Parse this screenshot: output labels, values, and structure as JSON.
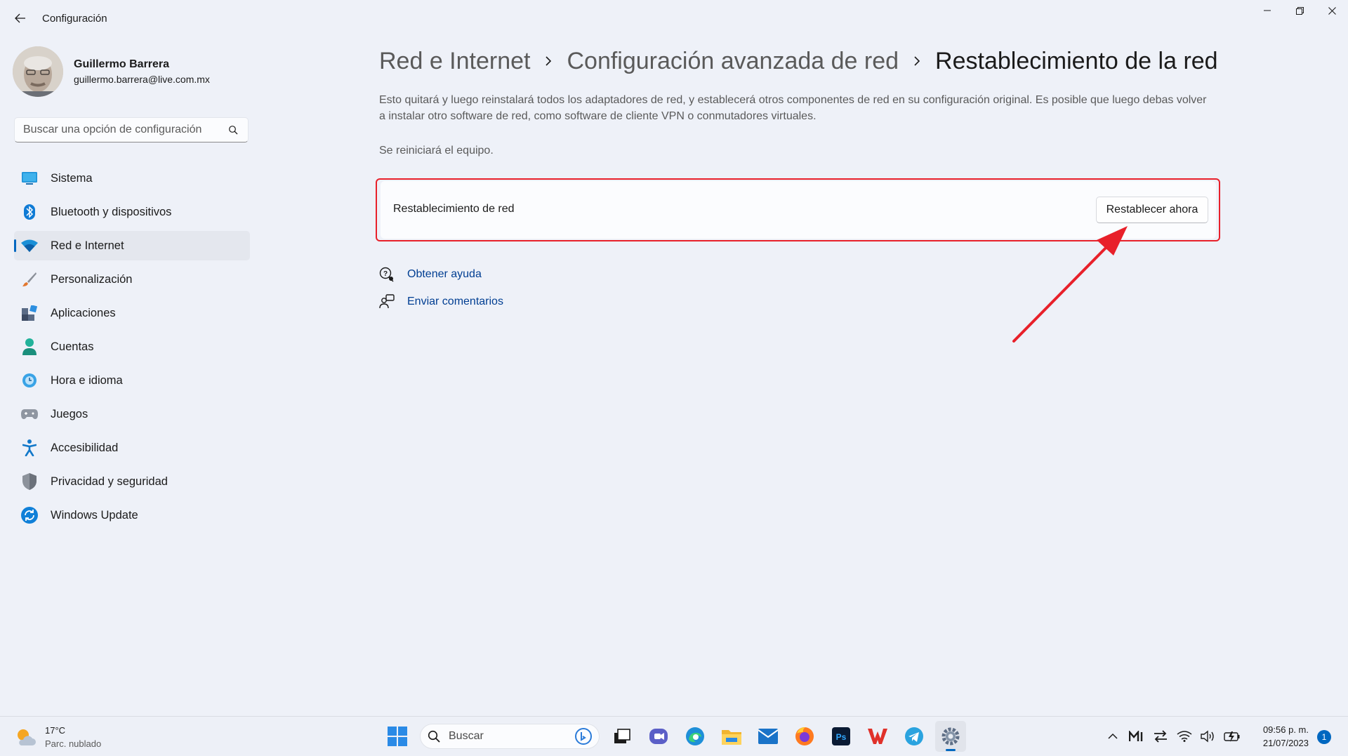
{
  "window": {
    "title": "Configuración"
  },
  "profile": {
    "name": "Guillermo Barrera",
    "email": "guillermo.barrera@live.com.mx"
  },
  "search": {
    "placeholder": "Buscar una opción de configuración"
  },
  "sidebar": {
    "items": [
      {
        "label": "Sistema",
        "icon": "system-icon"
      },
      {
        "label": "Bluetooth y dispositivos",
        "icon": "bluetooth-icon"
      },
      {
        "label": "Red e Internet",
        "icon": "wifi-icon",
        "active": true
      },
      {
        "label": "Personalización",
        "icon": "brush-icon"
      },
      {
        "label": "Aplicaciones",
        "icon": "apps-icon"
      },
      {
        "label": "Cuentas",
        "icon": "account-icon"
      },
      {
        "label": "Hora e idioma",
        "icon": "time-language-icon"
      },
      {
        "label": "Juegos",
        "icon": "gamepad-icon"
      },
      {
        "label": "Accesibilidad",
        "icon": "accessibility-icon"
      },
      {
        "label": "Privacidad y seguridad",
        "icon": "shield-icon"
      },
      {
        "label": "Windows Update",
        "icon": "update-icon"
      }
    ]
  },
  "breadcrumb": {
    "items": [
      "Red e Internet",
      "Configuración avanzada de red"
    ],
    "current": "Restablecimiento de la red"
  },
  "main": {
    "description": "Esto quitará y luego reinstalará todos los adaptadores de red, y establecerá otros componentes de red en su configuración original. Es posible que luego debas volver a instalar otro software de red, como software de cliente VPN o conmutadores virtuales.",
    "restart_note": "Se reiniciará el equipo.",
    "reset_card": {
      "label": "Restablecimiento de red",
      "button": "Restablecer ahora"
    },
    "links": {
      "help": "Obtener ayuda",
      "feedback": "Enviar comentarios"
    }
  },
  "taskbar": {
    "weather": {
      "temp": "17°C",
      "desc": "Parc. nublado"
    },
    "search_label": "Buscar",
    "clock": {
      "time": "09:56 p. m.",
      "date": "21/07/2023"
    },
    "notification_count": "1",
    "apps": [
      "start-icon",
      "search-icon",
      "bing-icon",
      "task-view-icon",
      "teams-icon",
      "edge-icon",
      "file-explorer-icon",
      "mail-icon",
      "firefox-icon",
      "photoshop-icon",
      "wps-icon",
      "telegram-icon",
      "settings-icon"
    ]
  },
  "colors": {
    "accent": "#0067c0",
    "highlight": "#e8202a",
    "link": "#003e92",
    "background": "#eef1f8"
  }
}
